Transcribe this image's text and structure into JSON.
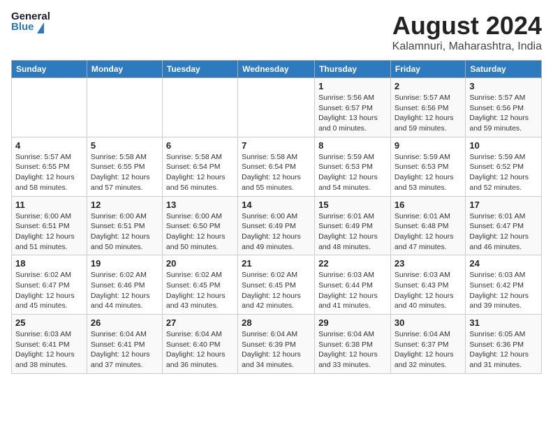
{
  "header": {
    "logo_line1": "General",
    "logo_line2": "Blue",
    "title": "August 2024",
    "subtitle": "Kalamnuri, Maharashtra, India"
  },
  "calendar": {
    "days_of_week": [
      "Sunday",
      "Monday",
      "Tuesday",
      "Wednesday",
      "Thursday",
      "Friday",
      "Saturday"
    ],
    "weeks": [
      [
        {
          "day": "",
          "info": ""
        },
        {
          "day": "",
          "info": ""
        },
        {
          "day": "",
          "info": ""
        },
        {
          "day": "",
          "info": ""
        },
        {
          "day": "1",
          "info": "Sunrise: 5:56 AM\nSunset: 6:57 PM\nDaylight: 13 hours\nand 0 minutes."
        },
        {
          "day": "2",
          "info": "Sunrise: 5:57 AM\nSunset: 6:56 PM\nDaylight: 12 hours\nand 59 minutes."
        },
        {
          "day": "3",
          "info": "Sunrise: 5:57 AM\nSunset: 6:56 PM\nDaylight: 12 hours\nand 59 minutes."
        }
      ],
      [
        {
          "day": "4",
          "info": "Sunrise: 5:57 AM\nSunset: 6:55 PM\nDaylight: 12 hours\nand 58 minutes."
        },
        {
          "day": "5",
          "info": "Sunrise: 5:58 AM\nSunset: 6:55 PM\nDaylight: 12 hours\nand 57 minutes."
        },
        {
          "day": "6",
          "info": "Sunrise: 5:58 AM\nSunset: 6:54 PM\nDaylight: 12 hours\nand 56 minutes."
        },
        {
          "day": "7",
          "info": "Sunrise: 5:58 AM\nSunset: 6:54 PM\nDaylight: 12 hours\nand 55 minutes."
        },
        {
          "day": "8",
          "info": "Sunrise: 5:59 AM\nSunset: 6:53 PM\nDaylight: 12 hours\nand 54 minutes."
        },
        {
          "day": "9",
          "info": "Sunrise: 5:59 AM\nSunset: 6:53 PM\nDaylight: 12 hours\nand 53 minutes."
        },
        {
          "day": "10",
          "info": "Sunrise: 5:59 AM\nSunset: 6:52 PM\nDaylight: 12 hours\nand 52 minutes."
        }
      ],
      [
        {
          "day": "11",
          "info": "Sunrise: 6:00 AM\nSunset: 6:51 PM\nDaylight: 12 hours\nand 51 minutes."
        },
        {
          "day": "12",
          "info": "Sunrise: 6:00 AM\nSunset: 6:51 PM\nDaylight: 12 hours\nand 50 minutes."
        },
        {
          "day": "13",
          "info": "Sunrise: 6:00 AM\nSunset: 6:50 PM\nDaylight: 12 hours\nand 50 minutes."
        },
        {
          "day": "14",
          "info": "Sunrise: 6:00 AM\nSunset: 6:49 PM\nDaylight: 12 hours\nand 49 minutes."
        },
        {
          "day": "15",
          "info": "Sunrise: 6:01 AM\nSunset: 6:49 PM\nDaylight: 12 hours\nand 48 minutes."
        },
        {
          "day": "16",
          "info": "Sunrise: 6:01 AM\nSunset: 6:48 PM\nDaylight: 12 hours\nand 47 minutes."
        },
        {
          "day": "17",
          "info": "Sunrise: 6:01 AM\nSunset: 6:47 PM\nDaylight: 12 hours\nand 46 minutes."
        }
      ],
      [
        {
          "day": "18",
          "info": "Sunrise: 6:02 AM\nSunset: 6:47 PM\nDaylight: 12 hours\nand 45 minutes."
        },
        {
          "day": "19",
          "info": "Sunrise: 6:02 AM\nSunset: 6:46 PM\nDaylight: 12 hours\nand 44 minutes."
        },
        {
          "day": "20",
          "info": "Sunrise: 6:02 AM\nSunset: 6:45 PM\nDaylight: 12 hours\nand 43 minutes."
        },
        {
          "day": "21",
          "info": "Sunrise: 6:02 AM\nSunset: 6:45 PM\nDaylight: 12 hours\nand 42 minutes."
        },
        {
          "day": "22",
          "info": "Sunrise: 6:03 AM\nSunset: 6:44 PM\nDaylight: 12 hours\nand 41 minutes."
        },
        {
          "day": "23",
          "info": "Sunrise: 6:03 AM\nSunset: 6:43 PM\nDaylight: 12 hours\nand 40 minutes."
        },
        {
          "day": "24",
          "info": "Sunrise: 6:03 AM\nSunset: 6:42 PM\nDaylight: 12 hours\nand 39 minutes."
        }
      ],
      [
        {
          "day": "25",
          "info": "Sunrise: 6:03 AM\nSunset: 6:41 PM\nDaylight: 12 hours\nand 38 minutes."
        },
        {
          "day": "26",
          "info": "Sunrise: 6:04 AM\nSunset: 6:41 PM\nDaylight: 12 hours\nand 37 minutes."
        },
        {
          "day": "27",
          "info": "Sunrise: 6:04 AM\nSunset: 6:40 PM\nDaylight: 12 hours\nand 36 minutes."
        },
        {
          "day": "28",
          "info": "Sunrise: 6:04 AM\nSunset: 6:39 PM\nDaylight: 12 hours\nand 34 minutes."
        },
        {
          "day": "29",
          "info": "Sunrise: 6:04 AM\nSunset: 6:38 PM\nDaylight: 12 hours\nand 33 minutes."
        },
        {
          "day": "30",
          "info": "Sunrise: 6:04 AM\nSunset: 6:37 PM\nDaylight: 12 hours\nand 32 minutes."
        },
        {
          "day": "31",
          "info": "Sunrise: 6:05 AM\nSunset: 6:36 PM\nDaylight: 12 hours\nand 31 minutes."
        }
      ]
    ]
  }
}
